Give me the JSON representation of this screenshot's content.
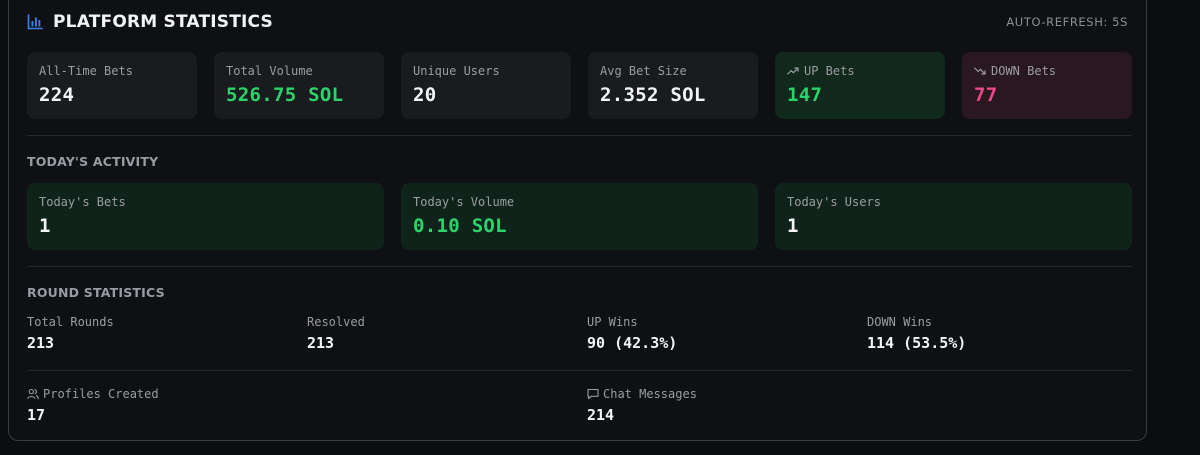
{
  "header": {
    "title": "PLATFORM STATISTICS",
    "auto_refresh": "AUTO-REFRESH: 5S",
    "icon": "bar-chart-icon"
  },
  "overview": [
    {
      "label": "All-Time Bets",
      "value": "224"
    },
    {
      "label": "Total Volume",
      "value": "526.75 SOL"
    },
    {
      "label": "Unique Users",
      "value": "20"
    },
    {
      "label": "Avg Bet Size",
      "value": "2.352 SOL"
    },
    {
      "label": "UP Bets",
      "value": "147",
      "icon": "trending-up-icon"
    },
    {
      "label": "DOWN Bets",
      "value": "77",
      "icon": "trending-down-icon"
    }
  ],
  "today": {
    "title": "TODAY'S ACTIVITY",
    "items": [
      {
        "label": "Today's Bets",
        "value": "1"
      },
      {
        "label": "Today's Volume",
        "value": "0.10 SOL"
      },
      {
        "label": "Today's Users",
        "value": "1"
      }
    ]
  },
  "rounds": {
    "title": "ROUND STATISTICS",
    "items": [
      {
        "label": "Total Rounds",
        "value": "213"
      },
      {
        "label": "Resolved",
        "value": "213"
      },
      {
        "label": "UP Wins",
        "value": "90 (42.3%)"
      },
      {
        "label": "DOWN Wins",
        "value": "114 (53.5%)"
      }
    ],
    "extra": [
      {
        "label": "Profiles Created",
        "value": "17",
        "icon": "users-icon"
      },
      {
        "label": "Chat Messages",
        "value": "214",
        "icon": "chat-icon"
      }
    ]
  },
  "colors": {
    "green": "#2bd46a",
    "pink": "#f0478c",
    "accent_blue": "#3b82f6"
  }
}
